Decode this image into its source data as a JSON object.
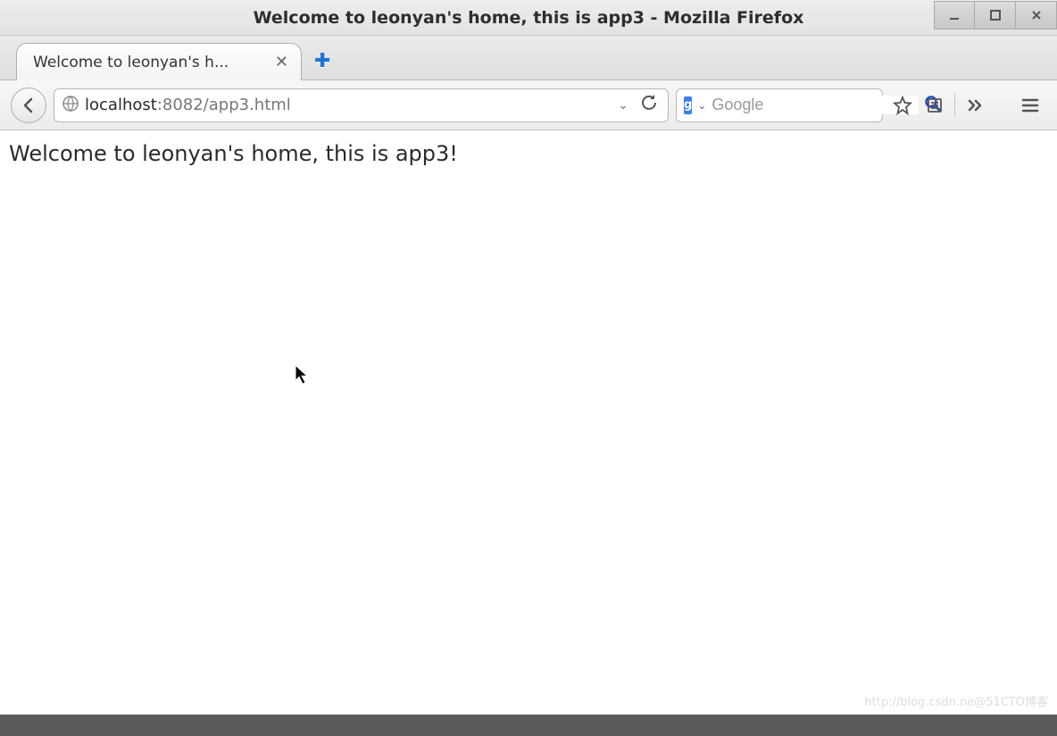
{
  "window": {
    "title": "Welcome to leonyan's home, this is app3 - Mozilla Firefox"
  },
  "tab": {
    "title": "Welcome to leonyan's h..."
  },
  "urlbar": {
    "host": "localhost",
    "rest": ":8082/app3.html"
  },
  "searchbar": {
    "engine_badge": "g",
    "placeholder": "Google"
  },
  "page": {
    "text": "Welcome to leonyan's home, this is app3!"
  },
  "watermark": "http://blog.csdn.ne@51CTO博客"
}
